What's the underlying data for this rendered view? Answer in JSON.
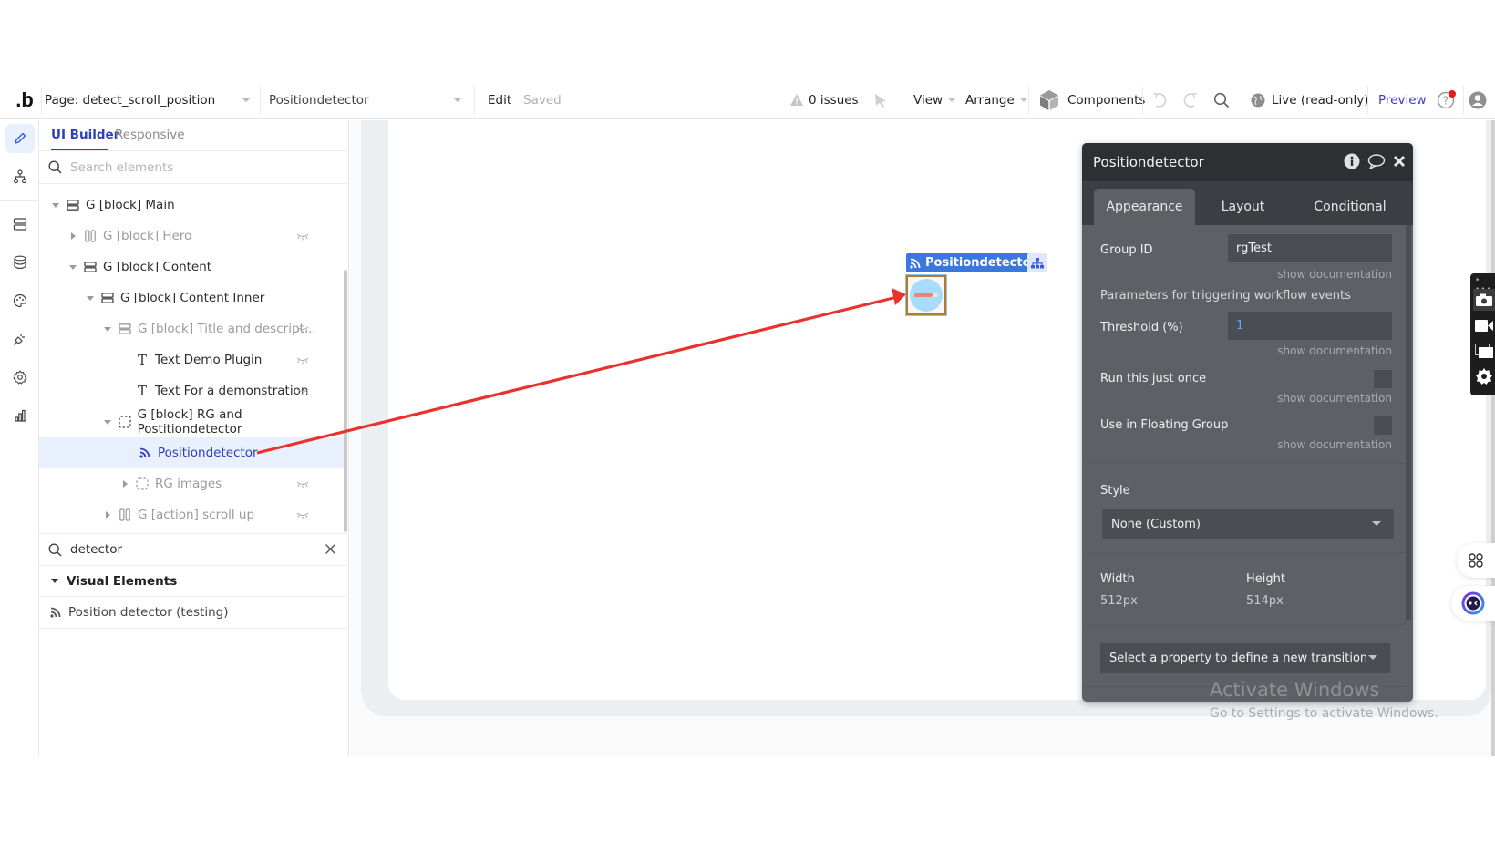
{
  "topbar": {
    "logo": ".b",
    "page_select": "Page: detect_scroll_position",
    "element_select": "Positiondetector",
    "edit": "Edit",
    "saved": "Saved",
    "issues": "0 issues",
    "view": "View",
    "arrange": "Arrange",
    "components": "Components",
    "live": "Live (read-only)",
    "preview": "Preview"
  },
  "rail": {
    "items": [
      "design-pencil",
      "structure-tree",
      "elements-stack",
      "data-database",
      "styles-palette",
      "plugins-plug",
      "settings-gear",
      "logs-chart"
    ]
  },
  "left_panel": {
    "tabs": [
      {
        "label": "UI Builder",
        "active": true
      },
      {
        "label": "Responsive",
        "active": false
      }
    ],
    "search_placeholder": "Search elements",
    "tree": [
      {
        "label": "G [block] Main",
        "icon": "group-rows",
        "expanded": true,
        "depth": 0,
        "hidden": false
      },
      {
        "label": "G [block] Hero",
        "icon": "group-columns",
        "expanded": false,
        "depth": 1,
        "hidden": true
      },
      {
        "label": "G [block] Content",
        "icon": "group-rows",
        "expanded": true,
        "depth": 1,
        "hidden": false
      },
      {
        "label": "G [block] Content Inner",
        "icon": "group-rows",
        "expanded": true,
        "depth": 2,
        "hidden": false
      },
      {
        "label": "G [block] Title and descript...",
        "icon": "group-rows",
        "expanded": true,
        "depth": 3,
        "hidden": true
      },
      {
        "label": "Text Demo Plugin",
        "icon": "text",
        "depth": 4,
        "hidden": false
      },
      {
        "label": "Text For a demonstration",
        "icon": "text",
        "depth": 4,
        "hidden": false
      },
      {
        "label": "G [block] RG and Postitiondetector",
        "icon": "group-dashed",
        "expanded": true,
        "depth": 3,
        "hidden": false
      },
      {
        "label": "Positiondetector",
        "icon": "rss",
        "depth": 4,
        "selected": true
      },
      {
        "label": "RG images",
        "icon": "repeating-group",
        "expanded": false,
        "depth": 4,
        "hidden": true
      },
      {
        "label": "G [action] scroll up",
        "icon": "group-columns",
        "expanded": false,
        "depth": 3,
        "hidden": true
      }
    ],
    "element_search_value": "detector",
    "visual_elements_header": "Visual Elements",
    "visual_elements": [
      {
        "label": "Position detector (testing)",
        "icon": "rss"
      }
    ]
  },
  "canvas": {
    "element_label": "Positiondetector",
    "progress_fill": 0.75
  },
  "properties": {
    "title": "Positiondetector",
    "tabs": [
      {
        "label": "Appearance",
        "active": true
      },
      {
        "label": "Layout",
        "active": false
      },
      {
        "label": "Conditional",
        "active": false
      }
    ],
    "group_id_label": "Group ID",
    "group_id_value": "rgTest",
    "show_documentation": "show documentation",
    "params_header": "Parameters for triggering workflow events",
    "threshold_label": "Threshold (%)",
    "threshold_value": "1",
    "run_once_label": "Run this just once",
    "run_once_checked": false,
    "floating_label": "Use in Floating Group",
    "floating_checked": false,
    "style_label": "Style",
    "style_value": "None (Custom)",
    "width_label": "Width",
    "width_value": "512px",
    "height_label": "Height",
    "height_value": "514px",
    "transition_select": "Select a property to define a new transition"
  },
  "watermark": {
    "line1": "Activate Windows",
    "line2": "Go to Settings to activate Windows."
  },
  "colors": {
    "accent": "#2d3fb8",
    "selection_bg": "#e8f0fd",
    "element_label_bg": "#3a78e0",
    "panel_bg": "#5d6166",
    "arrow": "#e8322e"
  }
}
